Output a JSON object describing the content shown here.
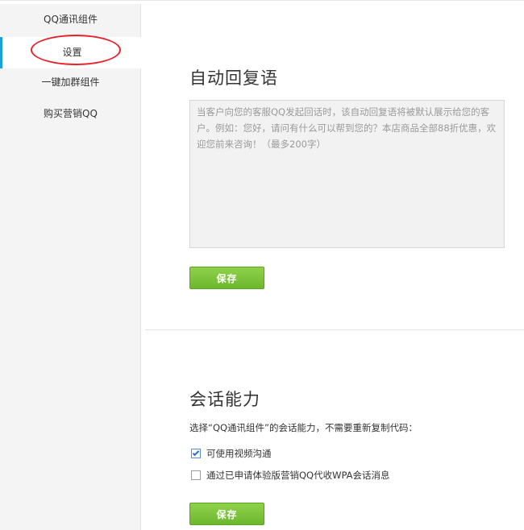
{
  "sidebar": {
    "items": [
      {
        "label": "QQ通讯组件",
        "active": false
      },
      {
        "label": "设置",
        "active": true
      },
      {
        "label": "一键加群组件",
        "active": false
      },
      {
        "label": "购买营销QQ",
        "active": false
      }
    ],
    "active_color": "#1e9fe0",
    "highlight_ring_color": "#e8232a"
  },
  "auto_reply": {
    "title": "自动回复语",
    "placeholder": "当客户向您的客服QQ发起回话时，该自动回复语将被默认展示给您的客户。例如：您好，请问有什么可以帮到您的？本店商品全部88折优惠，欢迎您前来咨询！（最多200字）",
    "save_label": "保存"
  },
  "session_ability": {
    "title": "会话能力",
    "description": "选择“QQ通讯组件”的会话能力，不需要重新复制代码：",
    "options": [
      {
        "label": "可使用视频沟通",
        "checked": true
      },
      {
        "label": "通过已申请体验版营销QQ代收WPA会话消息",
        "checked": false
      }
    ],
    "save_label": "保存"
  },
  "colors": {
    "save_button": "#7ac43a",
    "sidebar_bg": "#f4f4f4"
  }
}
